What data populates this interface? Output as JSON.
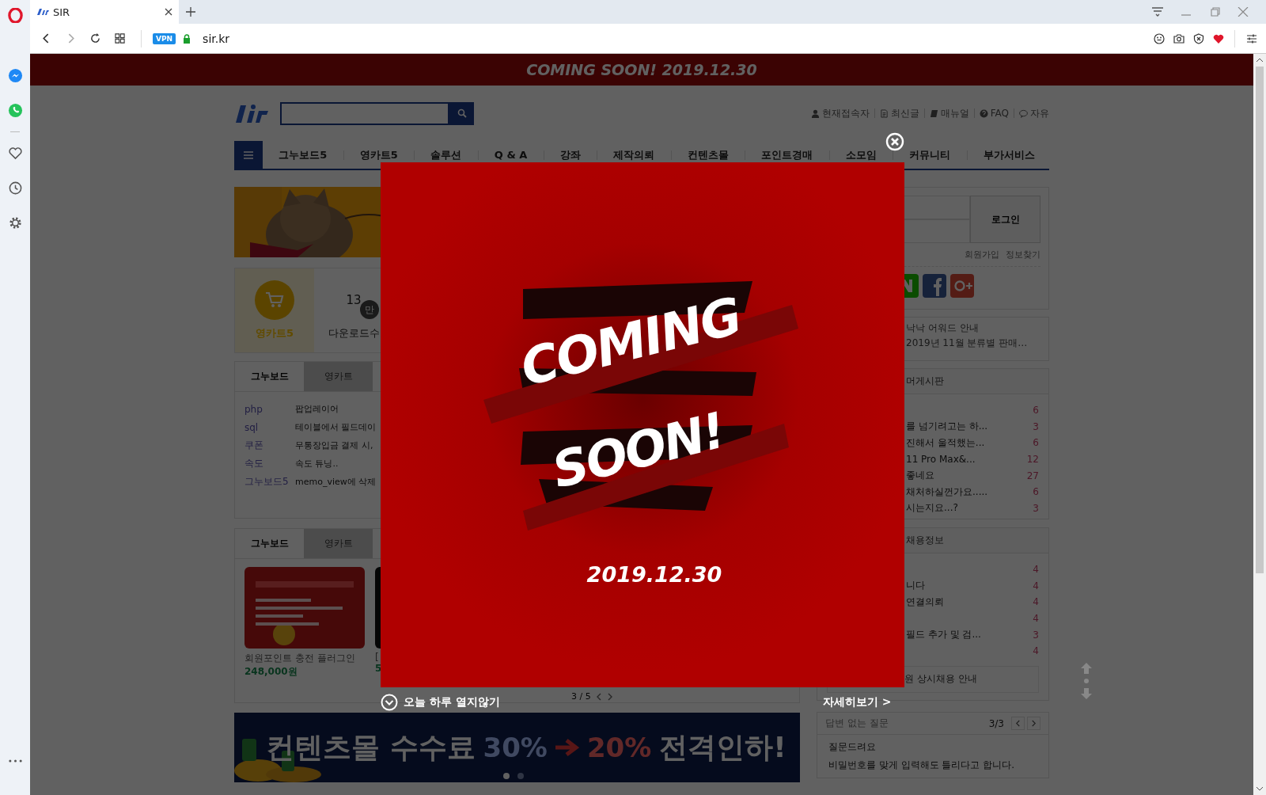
{
  "browser": {
    "tab_title": "SIR",
    "vpn_badge": "VPN",
    "url": "sir.kr"
  },
  "top_banner": "COMING SOON! 2019.12.30",
  "header": {
    "links": [
      "현재접속자",
      "최신글",
      "매뉴얼",
      "FAQ",
      "자유"
    ]
  },
  "nav": [
    "그누보드5",
    "영카트5",
    "솔루션",
    "Q & A",
    "강좌",
    "제작의뢰",
    "컨텐츠몰",
    "포인트경매",
    "소모임",
    "커뮤니티",
    "부가서비스"
  ],
  "stats": {
    "cart_label": "영카트5",
    "download_count": "13",
    "download_badge": "만",
    "download_label": "다운로드수"
  },
  "posts_panel": {
    "tabs": [
      {
        "label": "그누보드",
        "selected": true
      },
      {
        "label": "영카트",
        "selected": false
      }
    ],
    "rows": [
      {
        "category": "php",
        "title": "팝업레이어"
      },
      {
        "category": "sql",
        "title": "테이블에서 필드데이"
      },
      {
        "category": "쿠폰",
        "title": "무통장입금 결제 시,"
      },
      {
        "category": "속도",
        "title": "속도 튜닝.."
      },
      {
        "category": "그누보드5",
        "title": "memo_view에 삭제"
      }
    ]
  },
  "products_panel": {
    "tabs": [
      {
        "label": "그누보드",
        "selected": true
      },
      {
        "label": "영카트",
        "selected": false
      }
    ],
    "products": [
      {
        "name": "회원포인트 충전 플러그인",
        "price": "248,000원"
      },
      {
        "name": "[",
        "price": "5"
      }
    ],
    "pager": "3 / 5"
  },
  "promo_banner": {
    "text_1": "컨텐츠몰 수수료",
    "from": "30%",
    "to": "20%",
    "text_2": "전격인하!"
  },
  "login": {
    "button": "로그인",
    "links": [
      "회원가입",
      "정보찾기"
    ]
  },
  "notices": [
    "낙낙 어워드 안내",
    "2019년 11월 분류별 판매…"
  ],
  "humor_board": {
    "title": "머게시판",
    "rows": [
      {
        "count": "6"
      },
      {
        "title": "를 넘기려고는 하...",
        "count": "3"
      },
      {
        "title": "진해서 울적했는...",
        "count": "6"
      },
      {
        "title": "11 Pro Max&...",
        "count": "12"
      },
      {
        "title": "좋네요",
        "count": "27"
      },
      {
        "title": "채처하실껀가요.....",
        "count": "6"
      },
      {
        "title": "시는지요...?",
        "count": "3"
      }
    ]
  },
  "jobs_board": {
    "title": "채용정보",
    "rows": [
      {
        "count": "4"
      },
      {
        "title": "니다",
        "count": "4"
      },
      {
        "title": "연결의뢰",
        "count": "4"
      },
      {
        "count": "4"
      },
      {
        "title": "필드 추가 및 검...",
        "count": "3"
      },
      {
        "count": "4"
      }
    ],
    "featured": "원 상시채용 안내"
  },
  "unanswered": {
    "title": "답변 없는 질문",
    "pager": "3/3",
    "items": [
      "질문드려요",
      "비밀번호를 맞게 입력해도 틀리다고 합니다."
    ]
  },
  "popup": {
    "headline_1": "COMING",
    "headline_2": "SOON!",
    "date": "2019.12.30",
    "dismiss": "오늘 하루 열지않기",
    "more": "자세히보기 >"
  }
}
